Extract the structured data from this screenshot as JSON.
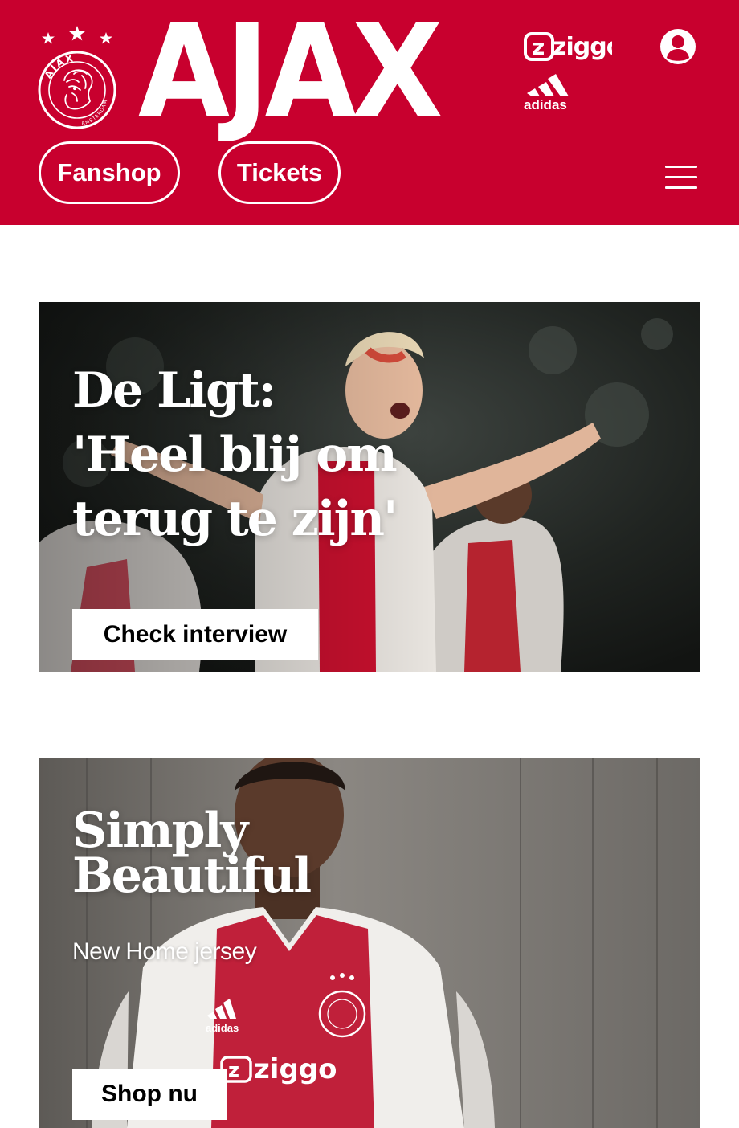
{
  "header": {
    "wordmark": "AJAX",
    "crest_text": "AJAX",
    "crest_subtext": "AMSTERDAM",
    "sponsor_1": "ziggo",
    "sponsor_2": "adidas",
    "account_icon": "user-icon",
    "menu_icon": "hamburger-menu-icon",
    "nav": {
      "fanshop_label": "Fanshop",
      "tickets_label": "Tickets"
    }
  },
  "cards": [
    {
      "headline_lines": [
        "De Ligt:",
        "'Heel blij om",
        "terug te zijn'"
      ],
      "cta_label": "Check interview"
    },
    {
      "headline_lines": [
        "Simply",
        "Beautiful"
      ],
      "subtitle": "New Home jersey",
      "cta_label": "Shop nu",
      "jersey_sponsor": "ziggo",
      "jersey_brand": "adidas"
    }
  ],
  "colors": {
    "brand_red": "#c8002e",
    "white": "#ffffff"
  }
}
